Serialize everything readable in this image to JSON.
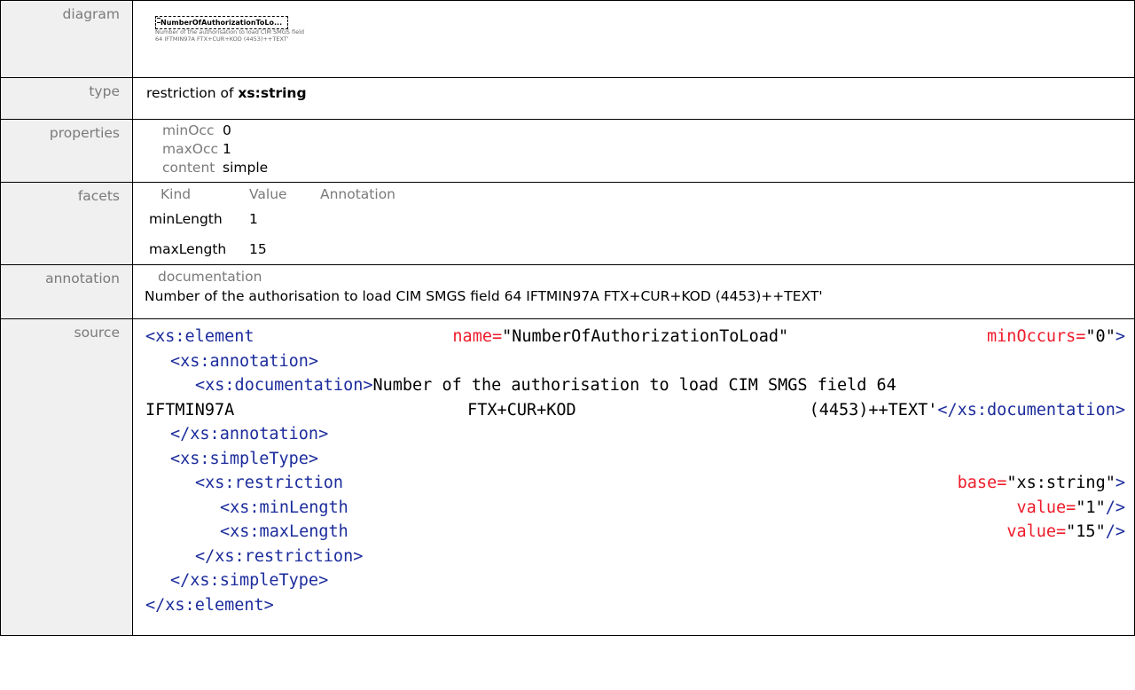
{
  "labels": {
    "diagram": "diagram",
    "type": "type",
    "properties": "properties",
    "facets": "facets",
    "annotation": "annotation",
    "source": "source"
  },
  "diagram": {
    "element_name": "NumberOfAuthorizationToLo...",
    "documentation": "Number of the authorisation to load  CIM SMGS field 64 IFTMIN97A FTX+CUR+KOD (4453)++TEXT'"
  },
  "type": {
    "prefix": "restriction of ",
    "base": "xs:string"
  },
  "properties": [
    {
      "key": "minOcc",
      "value": "0"
    },
    {
      "key": "maxOcc",
      "value": "1"
    },
    {
      "key": "content",
      "value": "simple"
    }
  ],
  "facets": {
    "headers": [
      "Kind",
      "Value",
      "Annotation"
    ],
    "rows": [
      {
        "kind": "minLength",
        "value": "1"
      },
      {
        "kind": "maxLength",
        "value": "15"
      }
    ]
  },
  "annotation": {
    "heading": "documentation",
    "text": "Number of the authorisation to load  CIM SMGS field 64 IFTMIN97A  FTX+CUR+KOD (4453)++TEXT'"
  },
  "source": {
    "l1": {
      "open": "<xs:element",
      "attr1": "name",
      "eq": "=",
      "val1": "\"NumberOfAuthorizationToLoad\"",
      "attr2": "minOccurs",
      "val2": "\"0\"",
      "close": ">"
    },
    "l2": "<xs:annotation>",
    "l3": {
      "open": "<xs:documentation>",
      "text": "Number of the authorisation to load  CIM SMGS field 64"
    },
    "l4": {
      "p1": "IFTMIN97A",
      "p2": "FTX+CUR+KOD",
      "p3": "(4453)++TEXT'",
      "close": "</xs:documentation>"
    },
    "l5": "</xs:annotation>",
    "l6": "<xs:simpleType>",
    "l7": {
      "open": "<xs:restriction",
      "attr": "base",
      "val": "\"xs:string\"",
      "close": ">"
    },
    "l8": {
      "open": "<xs:minLength",
      "attr": "value",
      "val": "\"1\"",
      "close": "/>"
    },
    "l9": {
      "open": "<xs:maxLength",
      "attr": "value",
      "val": "\"15\"",
      "close": "/>"
    },
    "l10": "</xs:restriction>",
    "l11": "</xs:simpleType>",
    "l12": "</xs:element>"
  }
}
